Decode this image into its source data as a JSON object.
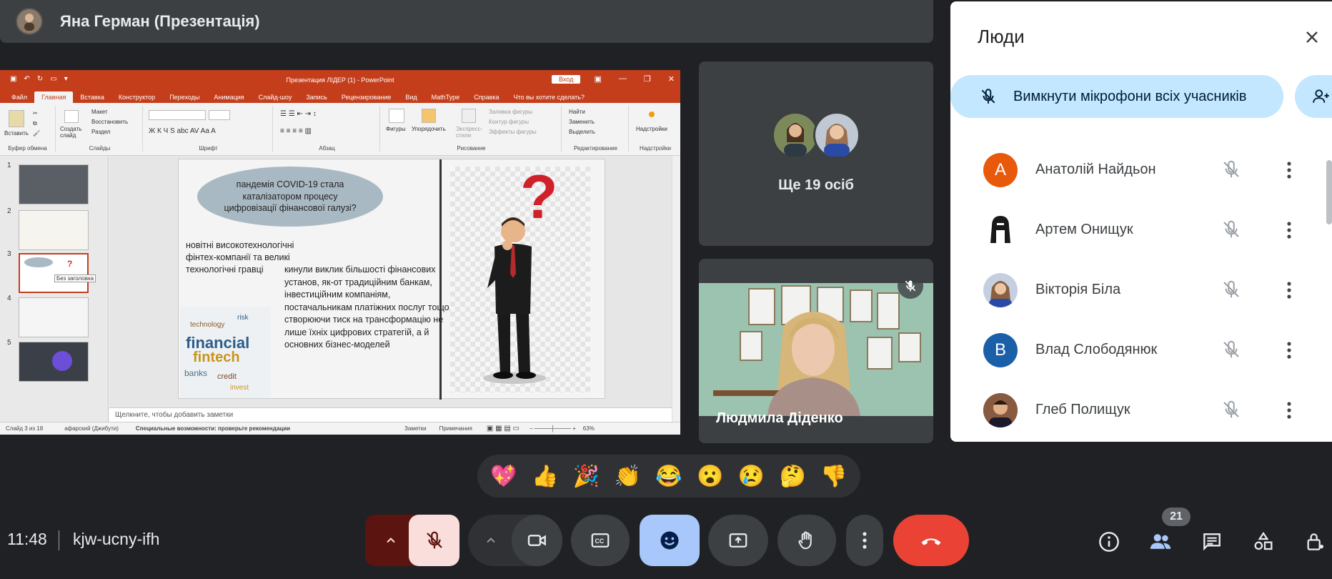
{
  "presenter_bar": {
    "name": "Яна Герман (Презентація)"
  },
  "powerpoint": {
    "window_title": "Презентация ЛІДЕР (1)  -  PowerPoint",
    "login_label": "Вход",
    "tabs": [
      "Файл",
      "Главная",
      "Вставка",
      "Конструктор",
      "Переходы",
      "Анимация",
      "Слайд-шоу",
      "Запись",
      "Рецензирование",
      "Вид",
      "MathType",
      "Справка",
      "Что вы хотите сделать?"
    ],
    "ribbon": {
      "paste": "Вставить",
      "new_slide": "Создать слайд",
      "layout": "Макет",
      "reset": "Восстановить",
      "section": "Раздел",
      "shapes": "Фигуры",
      "arrange": "Упорядочить",
      "quick_styles": "Экспресс-стили",
      "shape_fill": "Заливка фигуры",
      "shape_outline": "Контур фигуры",
      "shape_effects": "Эффекты фигуры",
      "find": "Найти",
      "replace": "Заменить",
      "select": "Выделить",
      "addins": "Надстройки",
      "groups": [
        "Буфер обмена",
        "Слайды",
        "Шрифт",
        "Абзац",
        "Рисование",
        "Редактирование",
        "Надстройки"
      ]
    },
    "thumbnails": [
      "1",
      "2",
      "3",
      "4",
      "5"
    ],
    "thumb_tooltip": "Без заголовка",
    "slide": {
      "bubble": "пандемія COVID-19 стала каталізатором процесу цифровізації фінансової галузі?",
      "left_text": "новітні високотехнологічні фінтех-компанії та великі технологічні гравці",
      "main_text": "кинули виклик більшості фінансових установ, як-от традиційним банкам, інвестиційним компаніям, постачальникам платіжних послуг тощо, створюючи тиск на трансформацію не лише їхніх цифрових стратегій, а й основних бізнес-моделей",
      "wordcloud_words": [
        "financial",
        "fintech",
        "technology",
        "banks",
        "credit",
        "risk",
        "invest"
      ]
    },
    "notes_placeholder": "Щелкните, чтобы добавить заметки",
    "status": {
      "slide_count": "Слайд 3 из 18",
      "language": "афарский (Джибути)",
      "accessibility": "Специальные возможности: проверьте рекомендации",
      "notes": "Заметки",
      "comments": "Примечания",
      "zoom": "63%"
    }
  },
  "tiles": {
    "more_label": "Ще 19 осіб",
    "speaker_name": "Людмила Діденко"
  },
  "people_panel": {
    "title": "Люди",
    "mute_all": "Вимкнути мікрофони всіх учасників",
    "participants": [
      {
        "name": "Анатолій Найдьон",
        "initial": "А",
        "color": "#e8590c"
      },
      {
        "name": "Артем Онищук",
        "initial": "",
        "color": "#ffffff"
      },
      {
        "name": "Вікторія Біла",
        "initial": "",
        "color": "#5a6e9a"
      },
      {
        "name": "Влад Слободянюк",
        "initial": "В",
        "color": "#1a5fa8"
      },
      {
        "name": "Глеб Полищук",
        "initial": "",
        "color": "#6b4a3a"
      }
    ]
  },
  "reactions": [
    "💖",
    "👍",
    "🎉",
    "👏",
    "😂",
    "😮",
    "😢",
    "🤔",
    "👎"
  ],
  "bottom_bar": {
    "time": "11:48",
    "meeting_code": "kjw-ucny-ifh",
    "participant_count": "21"
  },
  "colors": {
    "background": "#202124",
    "end_call": "#ea4335",
    "mic_off": "#f9dedc",
    "reactions_active": "#a8c7fa",
    "ppt_accent": "#c43e1c"
  }
}
